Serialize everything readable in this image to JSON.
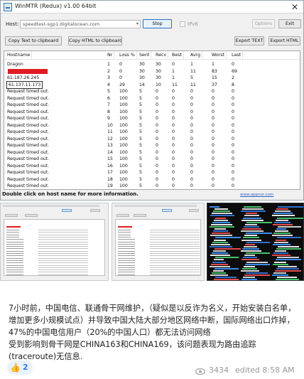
{
  "window": {
    "title": "WinMTR (Redux) v1.00 64bit",
    "close": "✕"
  },
  "controls": {
    "host_label": "Host:",
    "host_value": "speedtest-sgp1.digitalocean.com",
    "stop_label": "Stop",
    "ipv6_label": "IPv6",
    "options_label": "Options",
    "exit_label": "Exit",
    "copy_text_label": "Copy Text to clipboard",
    "copy_html_label": "Copy HTML to clipboard",
    "export_text_label": "Export TEXT",
    "export_html_label": "Export HTML"
  },
  "table": {
    "headers": [
      "Hostname",
      "Nr",
      "Loss %",
      "Sent",
      "Recv",
      "Best",
      "Avrg",
      "Worst",
      "Last"
    ],
    "rows": [
      [
        "Dragon",
        "1",
        "0",
        "30",
        "30",
        "0",
        "1",
        "1",
        "0"
      ],
      [
        "",
        "2",
        "0",
        "30",
        "30",
        "1",
        "11",
        "83",
        "69"
      ],
      [
        "61.187.26.245",
        "3",
        "0",
        "30",
        "30",
        "1",
        "5",
        "15",
        "2"
      ],
      [
        "61.137.11.173",
        "4",
        "29",
        "14",
        "10",
        "11",
        "11",
        "37",
        "8"
      ],
      [
        "Request timed out.",
        "5",
        "100",
        "5",
        "0",
        "0",
        "0",
        "0",
        "0"
      ],
      [
        "Request timed out.",
        "6",
        "100",
        "5",
        "0",
        "0",
        "0",
        "0",
        "0"
      ],
      [
        "Request timed out.",
        "7",
        "100",
        "5",
        "0",
        "0",
        "0",
        "0",
        "0"
      ],
      [
        "Request timed out.",
        "8",
        "100",
        "5",
        "0",
        "0",
        "0",
        "0",
        "0"
      ],
      [
        "Request timed out.",
        "9",
        "100",
        "5",
        "0",
        "0",
        "0",
        "0",
        "0"
      ],
      [
        "Request timed out.",
        "10",
        "100",
        "5",
        "0",
        "0",
        "0",
        "0",
        "0"
      ],
      [
        "Request timed out.",
        "11",
        "100",
        "5",
        "0",
        "0",
        "0",
        "0",
        "0"
      ],
      [
        "Request timed out.",
        "12",
        "100",
        "5",
        "0",
        "0",
        "0",
        "0",
        "0"
      ],
      [
        "Request timed out.",
        "13",
        "100",
        "5",
        "0",
        "0",
        "0",
        "0",
        "0"
      ],
      [
        "Request timed out.",
        "14",
        "100",
        "5",
        "0",
        "0",
        "0",
        "0",
        "0"
      ],
      [
        "Request timed out.",
        "15",
        "100",
        "5",
        "0",
        "0",
        "0",
        "0",
        "0"
      ],
      [
        "Request timed out.",
        "16",
        "100",
        "5",
        "0",
        "0",
        "0",
        "0",
        "0"
      ],
      [
        "Request timed out.",
        "17",
        "100",
        "5",
        "0",
        "0",
        "0",
        "0",
        "0"
      ],
      [
        "Request timed out.",
        "18",
        "100",
        "5",
        "0",
        "0",
        "0",
        "0",
        "0"
      ],
      [
        "Request timed out.",
        "19",
        "100",
        "5",
        "0",
        "0",
        "0",
        "0",
        "0"
      ]
    ]
  },
  "status": {
    "text": "Double click on host name for more information.",
    "link": "www.appnor.com"
  },
  "post": {
    "paragraph1": "7小时前，中国电信、联通骨干网维护，（疑似是以反诈为名义，开始安装白名单，增加更多小规模试点）并导致中国大陆大部分地区网络中断，国际网络出口炸掉，47%的中国电信用户（20%的中国人口）都无法访问网络",
    "paragraph2": "受到影响到骨干网是CHINA163和CHINA169，该问题表现为路由追踪(traceroute)无信息.",
    "reaction_icon": "👍",
    "reaction_count": "2",
    "views": "3434",
    "edited": "edited 8:58 AM"
  },
  "colors": {
    "redaction": "#e01b24",
    "link": "#2f63c0",
    "reaction_bg": "#eaf2ff",
    "reaction_text": "#3b7ad9"
  }
}
